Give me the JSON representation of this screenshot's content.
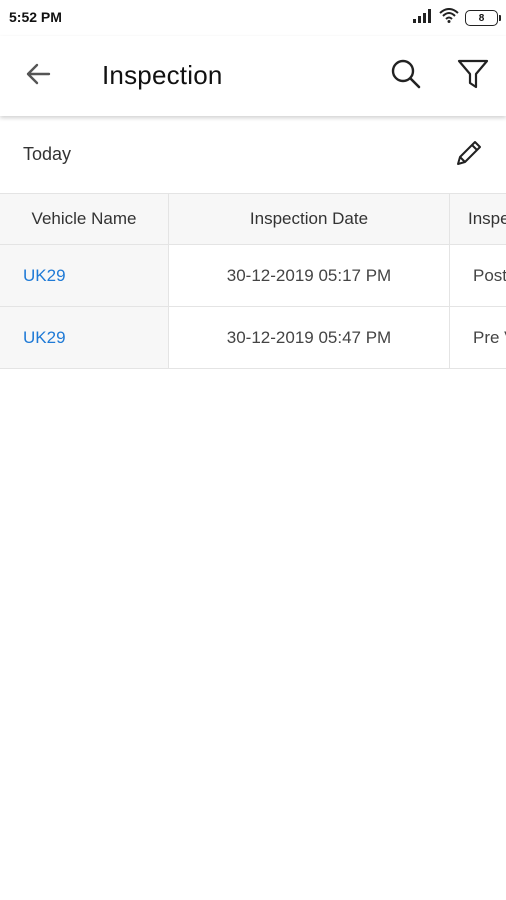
{
  "status_bar": {
    "time": "5:52 PM",
    "battery": "8"
  },
  "app_bar": {
    "title": "Inspection"
  },
  "section": {
    "label": "Today"
  },
  "table": {
    "headers": [
      "Vehicle Name",
      "Inspection Date",
      "Inspe"
    ],
    "rows": [
      {
        "vehicle": "UK29",
        "date": "30-12-2019 05:17 PM",
        "type": "Post"
      },
      {
        "vehicle": "UK29",
        "date": "30-12-2019 05:47 PM",
        "type": "Pre V"
      }
    ]
  },
  "colors": {
    "link": "#1f7ad6",
    "header_bg": "#f7f7f7",
    "divider": "#e4e4e4"
  },
  "icons": [
    "arrow-left-icon",
    "search-icon",
    "filter-icon",
    "pencil-icon",
    "signal-icon",
    "wifi-icon",
    "battery-icon"
  ]
}
